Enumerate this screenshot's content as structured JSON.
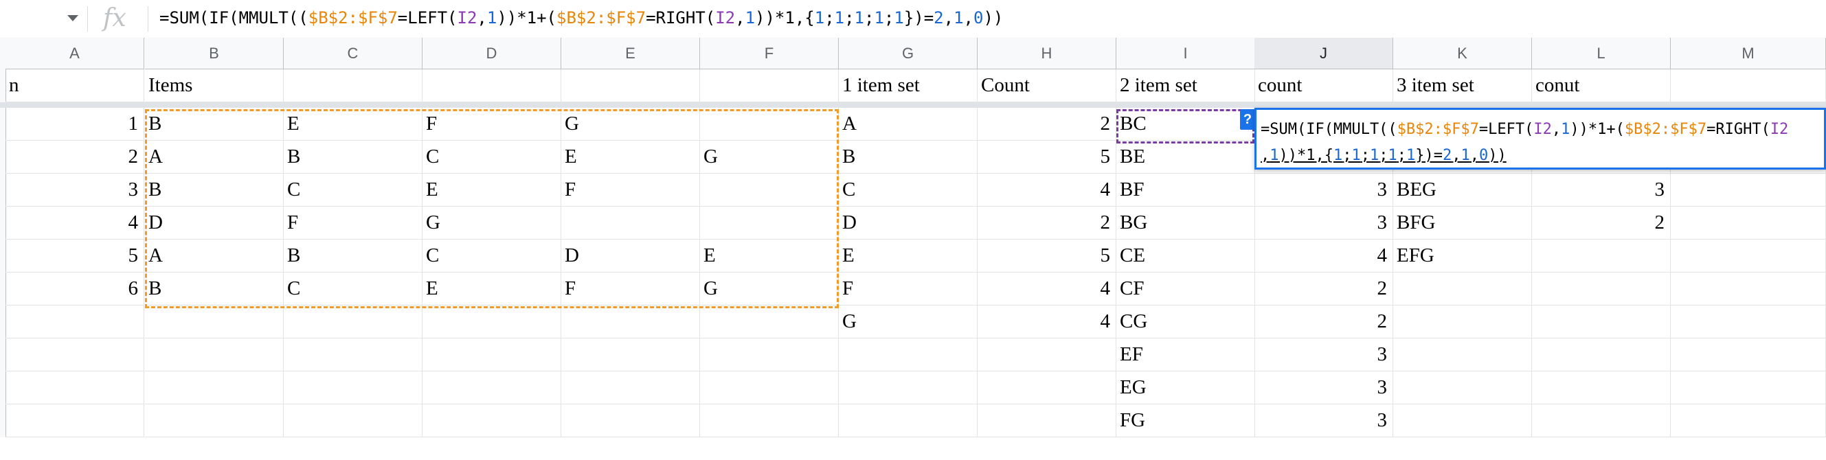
{
  "formula_bar": {
    "fx_label": "fx",
    "tokens": [
      {
        "t": "=SUM(IF(MMULT((",
        "k": "plain"
      },
      {
        "t": "$B$2:$F$7",
        "k": "range"
      },
      {
        "t": "=LEFT(",
        "k": "plain"
      },
      {
        "t": "I2",
        "k": "ref"
      },
      {
        "t": ",",
        "k": "plain"
      },
      {
        "t": "1",
        "k": "num"
      },
      {
        "t": "))*1+(",
        "k": "plain"
      },
      {
        "t": "$B$2:$F$7",
        "k": "range"
      },
      {
        "t": "=RIGHT(",
        "k": "plain"
      },
      {
        "t": "I2",
        "k": "ref"
      },
      {
        "t": ",",
        "k": "plain"
      },
      {
        "t": "1",
        "k": "num"
      },
      {
        "t": "))*1,{",
        "k": "plain"
      },
      {
        "t": "1",
        "k": "num"
      },
      {
        "t": ";",
        "k": "plain"
      },
      {
        "t": "1",
        "k": "num"
      },
      {
        "t": ";",
        "k": "plain"
      },
      {
        "t": "1",
        "k": "num"
      },
      {
        "t": ";",
        "k": "plain"
      },
      {
        "t": "1",
        "k": "num"
      },
      {
        "t": ";",
        "k": "plain"
      },
      {
        "t": "1",
        "k": "num"
      },
      {
        "t": "})=",
        "k": "plain"
      },
      {
        "t": "2",
        "k": "num"
      },
      {
        "t": ",",
        "k": "plain"
      },
      {
        "t": "1",
        "k": "num"
      },
      {
        "t": ",",
        "k": "plain"
      },
      {
        "t": "0",
        "k": "num"
      },
      {
        "t": "))",
        "k": "plain"
      }
    ]
  },
  "columns": [
    "A",
    "B",
    "C",
    "D",
    "E",
    "F",
    "G",
    "H",
    "I",
    "J",
    "K",
    "L",
    "M"
  ],
  "selected_column": "J",
  "header_row": [
    "n",
    "Items",
    "",
    "",
    "",
    "",
    "1 item set",
    "Count",
    "2 item set",
    "count",
    "3 item set",
    "conut",
    ""
  ],
  "rows": [
    [
      "1",
      "B",
      "E",
      "F",
      "G",
      "",
      "A",
      "2",
      "BC",
      "",
      "",
      "",
      ""
    ],
    [
      "2",
      "A",
      "B",
      "C",
      "E",
      "G",
      "B",
      "5",
      "BE",
      "",
      "",
      "",
      ""
    ],
    [
      "3",
      "B",
      "C",
      "E",
      "F",
      "",
      "C",
      "4",
      "BF",
      "3",
      "BEG",
      "3",
      ""
    ],
    [
      "4",
      "D",
      "F",
      "G",
      "",
      "",
      "D",
      "2",
      "BG",
      "3",
      "BFG",
      "2",
      ""
    ],
    [
      "5",
      "A",
      "B",
      "C",
      "D",
      "E",
      "E",
      "5",
      "CE",
      "4",
      "EFG",
      "",
      ""
    ],
    [
      "6",
      "B",
      "C",
      "E",
      "F",
      "G",
      "F",
      "4",
      "CF",
      "2",
      "",
      "",
      ""
    ],
    [
      "",
      "",
      "",
      "",
      "",
      "",
      "G",
      "4",
      "CG",
      "2",
      "",
      "",
      ""
    ],
    [
      "",
      "",
      "",
      "",
      "",
      "",
      "",
      "",
      "EF",
      "3",
      "",
      "",
      ""
    ],
    [
      "",
      "",
      "",
      "",
      "",
      "",
      "",
      "",
      "EG",
      "3",
      "",
      "",
      ""
    ],
    [
      "",
      "",
      "",
      "",
      "",
      "",
      "",
      "",
      "FG",
      "3",
      "",
      "",
      ""
    ]
  ],
  "editor": {
    "help_label": "?",
    "line1": [
      {
        "t": "=SUM(IF(MMULT((",
        "k": "plain"
      },
      {
        "t": "$B$2:$F$7",
        "k": "range"
      },
      {
        "t": "=LEFT(",
        "k": "plain"
      },
      {
        "t": "I2",
        "k": "ref"
      },
      {
        "t": ",",
        "k": "plain"
      },
      {
        "t": "1",
        "k": "num"
      },
      {
        "t": "))*1+(",
        "k": "plain"
      },
      {
        "t": "$B$2:$F$7",
        "k": "range"
      },
      {
        "t": "=RIGHT(",
        "k": "plain"
      },
      {
        "t": "I2",
        "k": "ref"
      }
    ],
    "line2": [
      {
        "t": ",",
        "k": "plain"
      },
      {
        "t": "1",
        "k": "num"
      },
      {
        "t": "))*1,{",
        "k": "plain"
      },
      {
        "t": "1",
        "k": "num"
      },
      {
        "t": ";",
        "k": "plain"
      },
      {
        "t": "1",
        "k": "num"
      },
      {
        "t": ";",
        "k": "plain"
      },
      {
        "t": "1",
        "k": "num"
      },
      {
        "t": ";",
        "k": "plain"
      },
      {
        "t": "1",
        "k": "num"
      },
      {
        "t": ";",
        "k": "plain"
      },
      {
        "t": "1",
        "k": "num"
      },
      {
        "t": "})=",
        "k": "plain"
      },
      {
        "t": "2",
        "k": "num"
      },
      {
        "t": ",",
        "k": "plain"
      },
      {
        "t": "1",
        "k": "num"
      },
      {
        "t": ",",
        "k": "plain"
      },
      {
        "t": "0",
        "k": "num"
      },
      {
        "t": "))",
        "k": "plain"
      }
    ]
  },
  "colors": {
    "range": "#e8860a",
    "ref": "#8e3ab3",
    "num": "#1967d2",
    "editor_border": "#1a73e8"
  }
}
